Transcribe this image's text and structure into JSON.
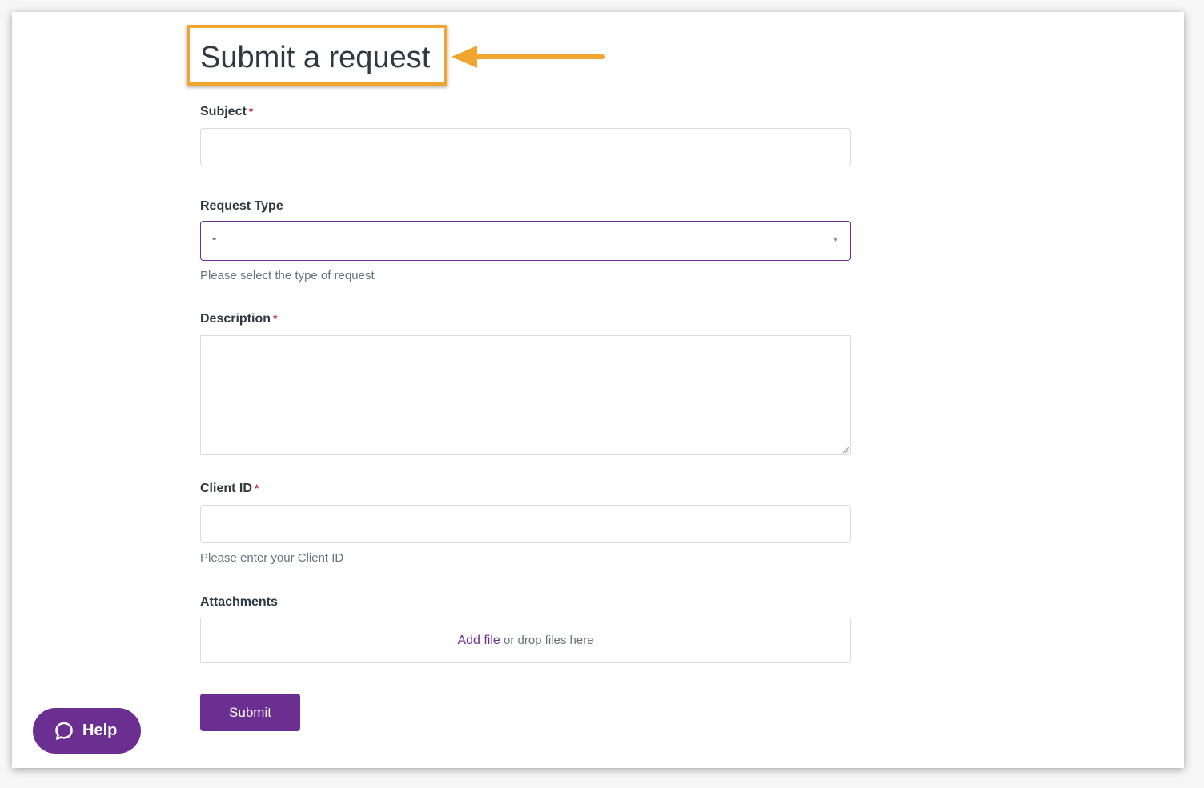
{
  "page": {
    "title": "Submit a request"
  },
  "form": {
    "subject": {
      "label": "Subject",
      "required_mark": "*",
      "value": ""
    },
    "request_type": {
      "label": "Request Type",
      "selected": "-",
      "hint": "Please select the type of request"
    },
    "description": {
      "label": "Description",
      "required_mark": "*",
      "value": ""
    },
    "client_id": {
      "label": "Client ID",
      "required_mark": "*",
      "value": "",
      "hint": "Please enter your Client ID"
    },
    "attachments": {
      "label": "Attachments",
      "add_file_link": "Add file",
      "drop_text": "or drop files here"
    },
    "submit_label": "Submit"
  },
  "help_widget": {
    "label": "Help",
    "icon": "chat-bubble-icon"
  },
  "colors": {
    "brand_purple": "#6b2f91",
    "annotation_orange": "#f0a530",
    "required_red": "#cc3340"
  }
}
